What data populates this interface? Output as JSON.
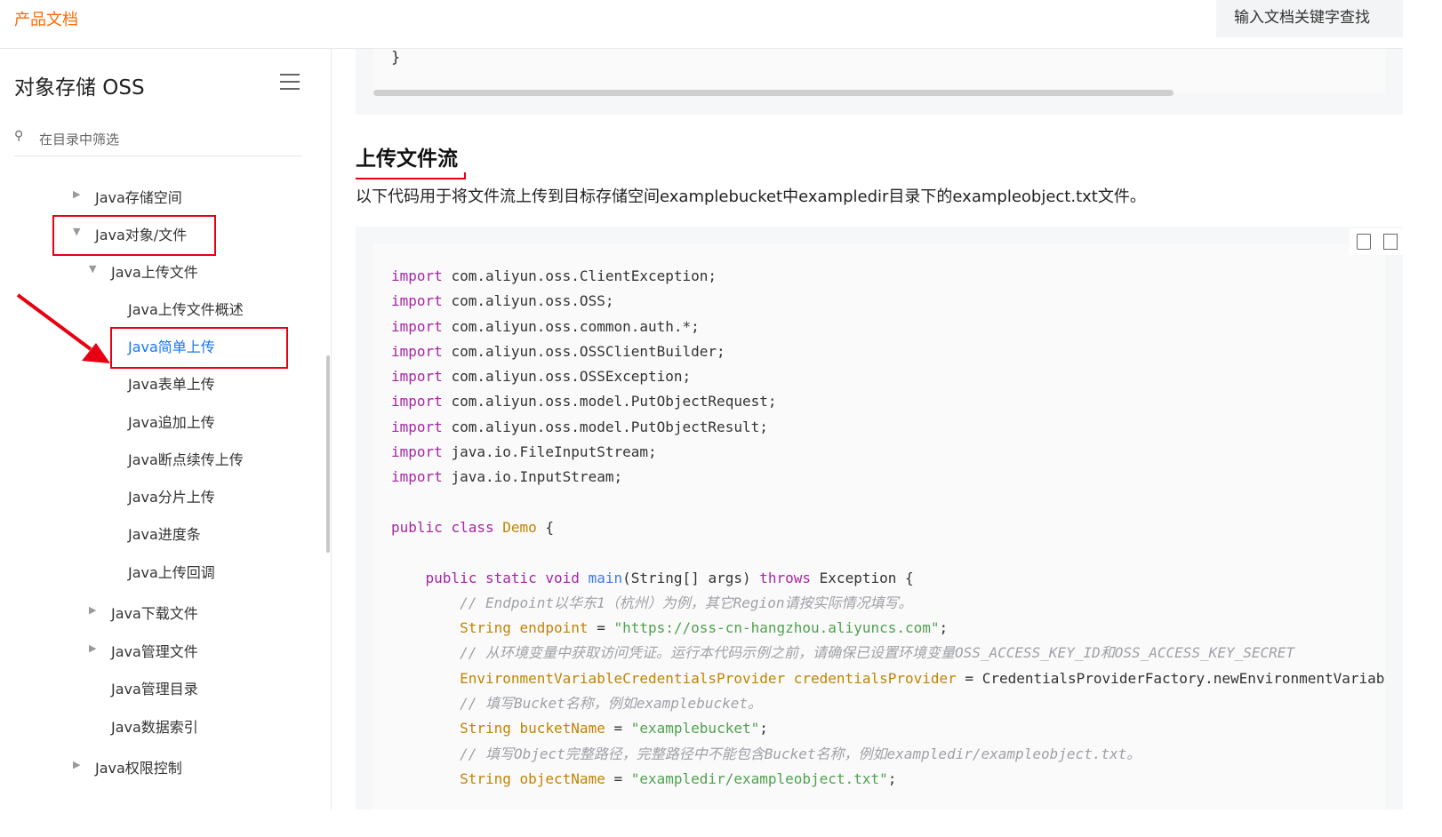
{
  "header": {
    "brand": "产品文档",
    "search_placeholder": "输入文档关键字查找"
  },
  "sidebar": {
    "title": "对象存储 OSS",
    "filter_placeholder": "在目录中筛选",
    "items": [
      {
        "label": "Java存储空间",
        "arrow": "▶"
      },
      {
        "label": "Java对象/文件",
        "arrow": "▼"
      },
      {
        "label": "Java上传文件",
        "arrow": "▼"
      },
      {
        "label": "Java上传文件概述"
      },
      {
        "label": "Java简单上传"
      },
      {
        "label": "Java表单上传"
      },
      {
        "label": "Java追加上传"
      },
      {
        "label": "Java断点续传上传"
      },
      {
        "label": "Java分片上传"
      },
      {
        "label": "Java进度条"
      },
      {
        "label": "Java上传回调"
      },
      {
        "label": "Java下载文件",
        "arrow": "▶"
      },
      {
        "label": "Java管理文件",
        "arrow": "▶"
      },
      {
        "label": "Java管理目录"
      },
      {
        "label": "Java数据索引"
      },
      {
        "label": "Java权限控制",
        "arrow": "▶"
      }
    ]
  },
  "main": {
    "prev_code_tail": "}",
    "heading": "上传文件流",
    "description": "以下代码用于将文件流上传到目标存储空间examplebucket中exampledir目录下的exampleobject.txt文件。",
    "code": {
      "imports": [
        "com.aliyun.oss.ClientException;",
        "com.aliyun.oss.OSS;",
        "com.aliyun.oss.common.auth.*;",
        "com.aliyun.oss.OSSClientBuilder;",
        "com.aliyun.oss.OSSException;",
        "com.aliyun.oss.model.PutObjectRequest;",
        "com.aliyun.oss.model.PutObjectResult;",
        "java.io.FileInputStream;",
        "java.io.InputStream;"
      ],
      "comment_endpoint": "// Endpoint以华东1（杭州）为例，其它Region请按实际情况填写。",
      "endpoint_value": "\"https://oss-cn-hangzhou.aliyuncs.com\"",
      "comment_credentials": "// 从环境变量中获取访问凭证。运行本代码示例之前，请确保已设置环境变量OSS_ACCESS_KEY_ID和OSS_ACCESS_KEY_SECRET",
      "credentials_rhs": "CredentialsProviderFactory.newEnvironmentVariableCredentialsProvider();",
      "comment_bucket": "// 填写Bucket名称，例如examplebucket。",
      "bucket_value": "\"examplebucket\"",
      "comment_object": "// 填写Object完整路径，完整路径中不能包含Bucket名称，例如exampledir/exampleobject.txt。",
      "object_value": "\"exampledir/exampleobject.txt\""
    }
  },
  "colors": {
    "brand": "#ff6a00",
    "active_link": "#1677ff",
    "highlight_box": "#e60012",
    "annotation_arrow": "#e60012"
  }
}
